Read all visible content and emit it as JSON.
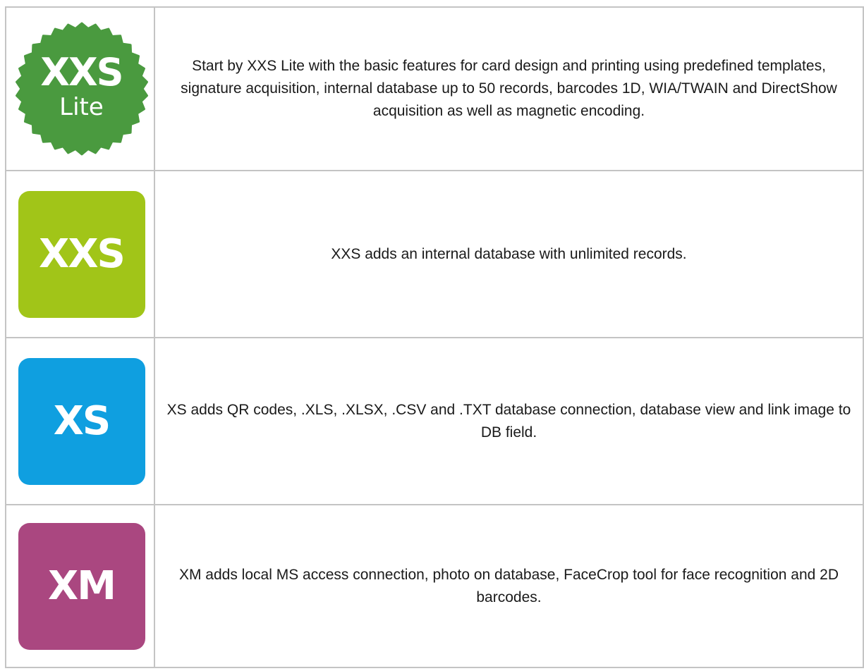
{
  "colors": {
    "xxs_lite": "#4a9a3f",
    "xxs": "#a1c518",
    "xs": "#0f9fe0",
    "xm": "#aa4780",
    "border": "#c4c4c4"
  },
  "editions": [
    {
      "logo_main": "XXS",
      "logo_sub": "Lite",
      "description": "Start by XXS Lite with the basic features for card design and printing using predefined templates, signature acquisition, internal database up to 50 records, barcodes 1D, WIA/TWAIN and DirectShow acquisition as well as magnetic encoding."
    },
    {
      "logo_main": "XXS",
      "description": "XXS adds an internal database with unlimited records."
    },
    {
      "logo_main": "XS",
      "description": "XS adds QR codes, .XLS, .XLSX, .CSV and .TXT database connection, database view and link image to DB field."
    },
    {
      "logo_main": "XM",
      "description": "XM adds local MS access connection, photo on database, FaceCrop tool for face recognition and 2D barcodes."
    }
  ]
}
